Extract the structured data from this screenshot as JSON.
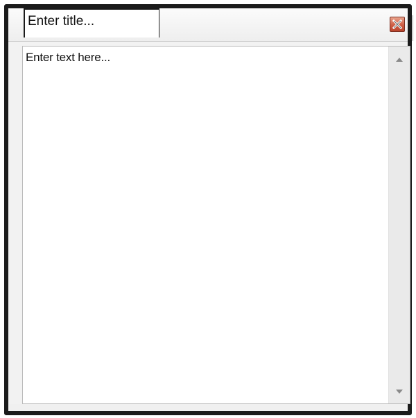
{
  "note_window": {
    "title_placeholder": "Enter title...",
    "body_placeholder": "Enter text here...",
    "close_icon": "close-icon",
    "close_color": "#cf5e45",
    "frame_color": "#1b1b1b"
  },
  "scrollbar": {
    "up_icon": "scroll-up-arrow-icon",
    "down_icon": "scroll-down-arrow-icon"
  }
}
